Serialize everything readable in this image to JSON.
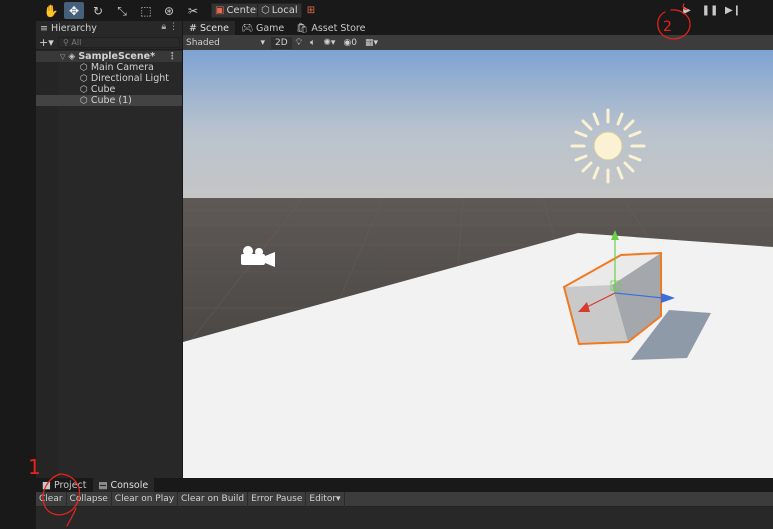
{
  "toolbar": {
    "tools": [
      "hand-tool",
      "move-tool",
      "rotate-tool",
      "scale-tool",
      "rect-tool",
      "transform-tool",
      "custom-tool"
    ],
    "center_label": "Center",
    "local_label": "Local",
    "play_controls": [
      "play",
      "pause",
      "step"
    ]
  },
  "hierarchy": {
    "tab_label": "Hierarchy",
    "search_placeholder": "All",
    "scene_name": "SampleScene*",
    "items": [
      {
        "label": "Main Camera"
      },
      {
        "label": "Directional Light"
      },
      {
        "label": "Cube"
      },
      {
        "label": "Cube (1)"
      }
    ]
  },
  "scene_view": {
    "tabs": [
      {
        "label": "Scene",
        "icon": "hash-icon"
      },
      {
        "label": "Game",
        "icon": "gamepad-icon"
      },
      {
        "label": "Asset Store",
        "icon": "bag-icon"
      }
    ],
    "shading": "Shaded",
    "mode_2d": "2D",
    "hidden_count": "0"
  },
  "bottom": {
    "tabs": [
      {
        "label": "Project",
        "icon": "folder-icon"
      },
      {
        "label": "Console",
        "icon": "console-icon"
      }
    ],
    "console_buttons": {
      "clear": "Clear",
      "collapse": "Collapse",
      "clear_on_play": "Clear on Play",
      "clear_on_build": "Clear on Build",
      "error_pause": "Error Pause",
      "editor": "Editor"
    }
  },
  "annotations": {
    "mark_1": "1",
    "mark_2": "2"
  },
  "colors": {
    "accent": "#46607c",
    "annotation": "#e8241b",
    "selection_outline": "#f07a22"
  }
}
